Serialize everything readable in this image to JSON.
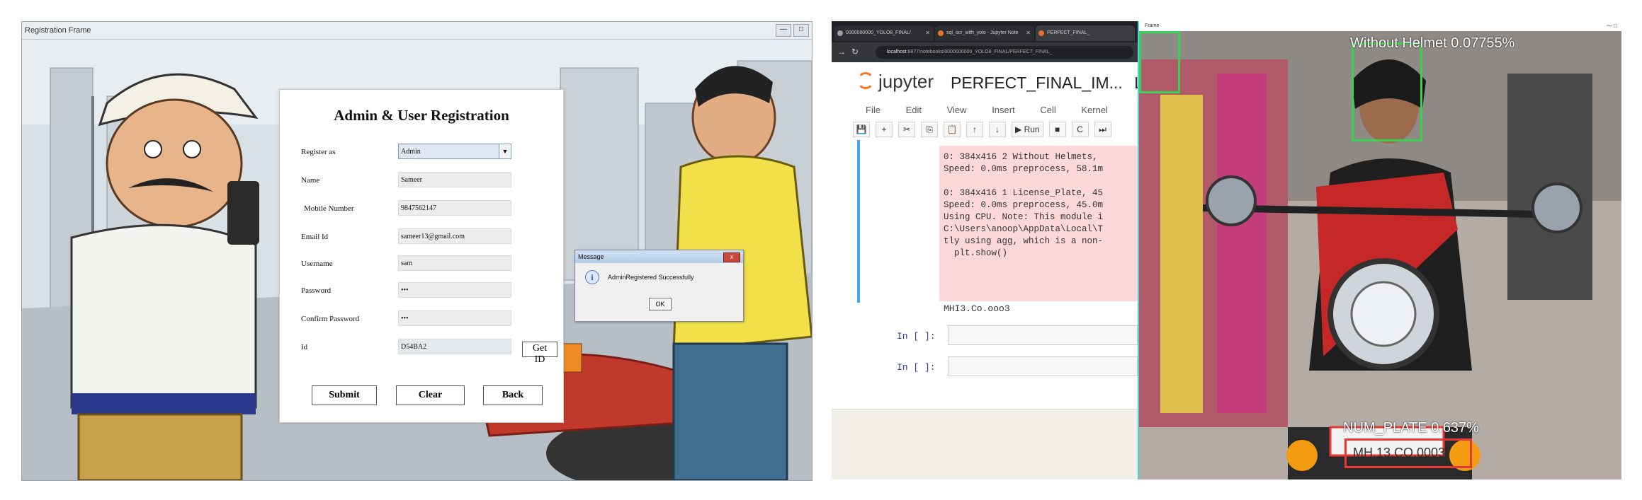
{
  "left": {
    "window_title": "Registration Frame",
    "window_controls": [
      "—",
      "□"
    ],
    "form": {
      "title": "Admin & User Registration",
      "fields": [
        {
          "label": "Register as",
          "value": "Admin"
        },
        {
          "label": "Name",
          "value": "Sameer"
        },
        {
          "label": "Mobile Number",
          "value": "9847562147"
        },
        {
          "label": "Email Id",
          "value": "sameer13@gmail.com"
        },
        {
          "label": "Username",
          "value": "sam"
        },
        {
          "label": "Password",
          "value": "•••"
        },
        {
          "label": "Confirm Password",
          "value": "•••"
        },
        {
          "label": "Id",
          "value": "D54BA2"
        }
      ],
      "get_id_label": "Get ID",
      "submit_label": "Submit",
      "clear_label": "Clear",
      "back_label": "Back"
    },
    "message_box": {
      "title": "Message",
      "text": "AdminRegistered Successfully",
      "ok_label": "OK",
      "info_glyph": "i",
      "close_glyph": "x"
    }
  },
  "right": {
    "tabs": [
      {
        "label": "0000000000_YOLO8_FINAL/"
      },
      {
        "label": "sql_ocr_with_yolo - Jupyter Note"
      },
      {
        "label": "PERFECT_FINAL_"
      }
    ],
    "url_host": "localhost",
    "url_path": ":8877/notebooks/0000000000_YOLO8_FINAL/PERFECT_FINAL_",
    "jupyter": {
      "brand": "jupyter",
      "notebook_title": "PERFECT_FINAL_IM...",
      "title_suffix": "L",
      "menu": [
        "File",
        "Edit",
        "View",
        "Insert",
        "Cell",
        "Kernel"
      ],
      "toolbar": [
        "💾",
        "+",
        "✂",
        "⎘",
        "📋",
        "↑",
        "↓",
        "▶ Run",
        "■",
        "C",
        "⏭"
      ],
      "output_lines": [
        "0: 384x416 2 Without Helmets,",
        "Speed: 0.0ms preprocess, 58.1m",
        "",
        "0: 384x416 1 License_Plate, 45",
        "Speed: 0.0ms preprocess, 45.0m",
        "Using CPU. Note: This module i",
        "C:\\Users\\anoop\\AppData\\Local\\T",
        "tly using agg, which is a non-",
        "  plt.show()"
      ],
      "plate_output": "MHI3.Co.ooo3",
      "input_prompts": [
        "In [ ]:",
        "In [ ]:"
      ]
    },
    "detection_window": {
      "title": "Frame",
      "controls": "—  □",
      "labels": {
        "face": "Without Helmet 0.07755%",
        "plate_label": "NUM_PLATE 0.637%",
        "plate_text": "MH.13.CO.0003"
      },
      "colors": {
        "face_box": "#39d353",
        "plate_box": "#e53935",
        "window_border": "#4dd0e1"
      }
    }
  }
}
